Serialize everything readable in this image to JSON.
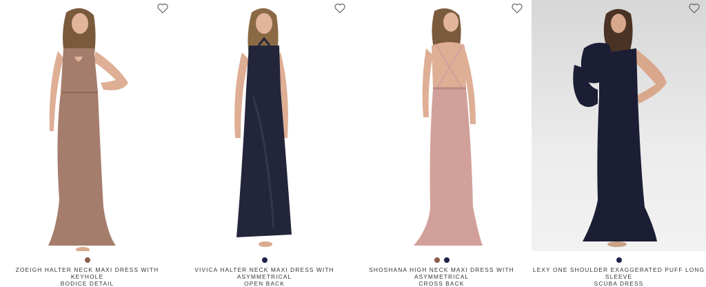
{
  "products": [
    {
      "title_line1": "ZOEIGH HALTER NECK MAXI DRESS WITH KEYHOLE",
      "title_line2": "BODICE DETAIL",
      "swatches": [
        "#8b5a4a"
      ],
      "dress_color": "#a57d6c",
      "image_bg": "white"
    },
    {
      "title_line1": "VIVICA HALTER NECK MAXI DRESS WITH ASYMMETRICAL",
      "title_line2": "OPEN BACK",
      "swatches": [
        "#1f2349"
      ],
      "dress_color": "#23253a",
      "image_bg": "white"
    },
    {
      "title_line1": "SHOSHANA HIGH NECK MAXI DRESS WITH ASYMMETRICAL",
      "title_line2": "CROSS BACK",
      "swatches": [
        "#8b5a4a",
        "#1f2349"
      ],
      "dress_color": "#d2a09a",
      "image_bg": "white"
    },
    {
      "title_line1": "LEXY ONE SHOULDER EXAGGERATED PUFF LONG SLEEVE",
      "title_line2": "SCUBA DRESS",
      "swatches": [
        "#1f2349"
      ],
      "dress_color": "#1b1e35",
      "image_bg": "grey"
    }
  ],
  "icons": {
    "wishlist": "heart-outline-icon"
  }
}
